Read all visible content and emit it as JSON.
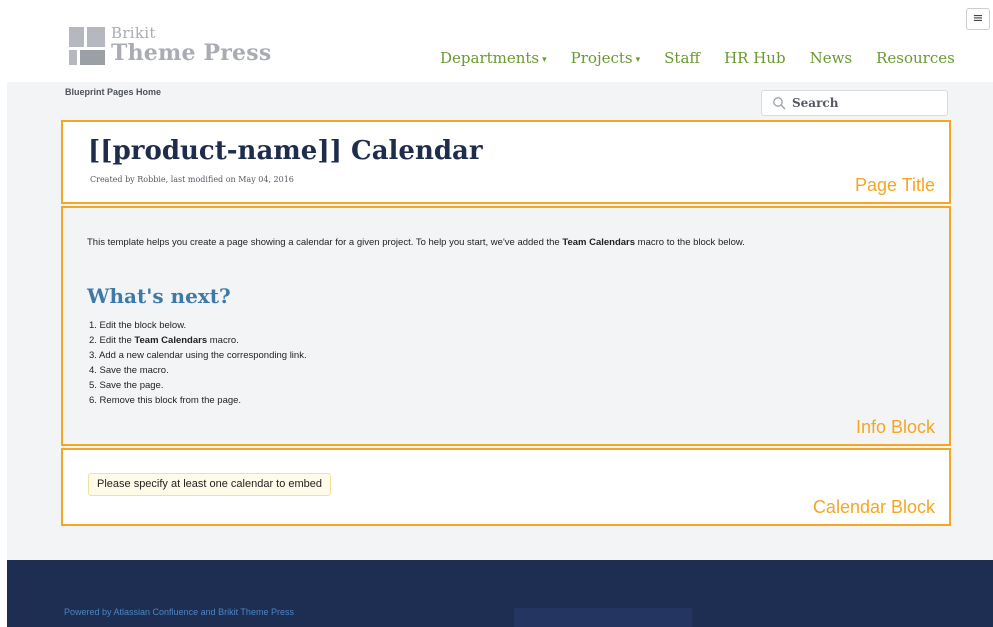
{
  "menu_toggle": {
    "glyph": "≡",
    "icon": "hamburger-menu-icon"
  },
  "logo": {
    "line1": "Brikit",
    "line2": "Theme Press"
  },
  "nav": {
    "items": [
      {
        "label": "Departments",
        "has_dropdown": true
      },
      {
        "label": "Projects",
        "has_dropdown": true
      },
      {
        "label": "Staff",
        "has_dropdown": false
      },
      {
        "label": "HR Hub",
        "has_dropdown": false
      },
      {
        "label": "News",
        "has_dropdown": false
      },
      {
        "label": "Resources",
        "has_dropdown": false
      }
    ],
    "caret": "▾",
    "color": "#6a9a2f"
  },
  "breadcrumb": {
    "label": "Blueprint Pages Home"
  },
  "search": {
    "label": "Search",
    "icon": "search-icon"
  },
  "title_block": {
    "title": "[[product-name]] Calendar",
    "meta": "Created by Robbie, last modified on May 04, 2016",
    "tag": "Page Title"
  },
  "info_block": {
    "intro_before": "This template helps you create a page showing a calendar for a given project. To help you start, we've added the ",
    "intro_bold": "Team Calendars",
    "intro_after": " macro to the block below.",
    "heading": "What's next?",
    "steps": [
      {
        "before": "1. Edit the block below.",
        "bold": "",
        "after": ""
      },
      {
        "before": "2. Edit the ",
        "bold": "Team Calendars",
        "after": " macro."
      },
      {
        "before": "3. Add a new calendar using the corresponding link.",
        "bold": "",
        "after": ""
      },
      {
        "before": "4. Save the macro.",
        "bold": "",
        "after": ""
      },
      {
        "before": "5. Save the page.",
        "bold": "",
        "after": ""
      },
      {
        "before": "6. Remove this block from the page.",
        "bold": "",
        "after": ""
      }
    ],
    "tag": "Info Block"
  },
  "calendar_block": {
    "notice": "Please specify at least one calendar to embed",
    "tag": "Calendar Block"
  },
  "footer": {
    "text": "Powered by Atlassian Confluence and Brikit Theme Press"
  },
  "colors": {
    "accent_outline": "#f5a623",
    "footer_bg": "#1e2d52",
    "heading_blue": "#3e7aa8",
    "title_navy": "#1f2d4d"
  }
}
